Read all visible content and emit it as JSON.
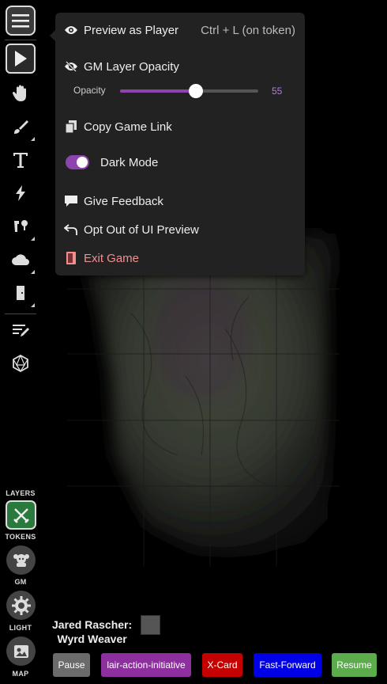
{
  "menu": {
    "preview": {
      "label": "Preview as Player",
      "shortcut": "Ctrl + L (on token)"
    },
    "gm_layer": {
      "label": "GM Layer Opacity",
      "slider_label": "Opacity",
      "value": "55",
      "fraction": 0.55
    },
    "copy_link": "Copy Game Link",
    "dark_mode": {
      "label": "Dark Mode",
      "on": true
    },
    "feedback": "Give Feedback",
    "opt_out": "Opt Out of UI Preview",
    "exit": "Exit Game"
  },
  "layers": {
    "heading": "LAYERS",
    "items": [
      "TOKENS",
      "GM",
      "LIGHT",
      "MAP"
    ],
    "active": "TOKENS"
  },
  "player": {
    "name": "Jared Rascher:",
    "character": "Wyrd Weaver"
  },
  "macros": [
    {
      "label": "Pause",
      "color": "#6b6b6b"
    },
    {
      "label": "lair-action-initiative",
      "color": "#8e2fa0"
    },
    {
      "label": "X-Card",
      "color": "#c40000"
    },
    {
      "label": "Fast-Forward",
      "color": "#0000e6"
    },
    {
      "label": "Resume",
      "color": "#5cab4c"
    }
  ],
  "colors": {
    "accent": "#8e44ad",
    "exit_text": "#f08f8f",
    "active_layer": "#2b7a3d"
  }
}
